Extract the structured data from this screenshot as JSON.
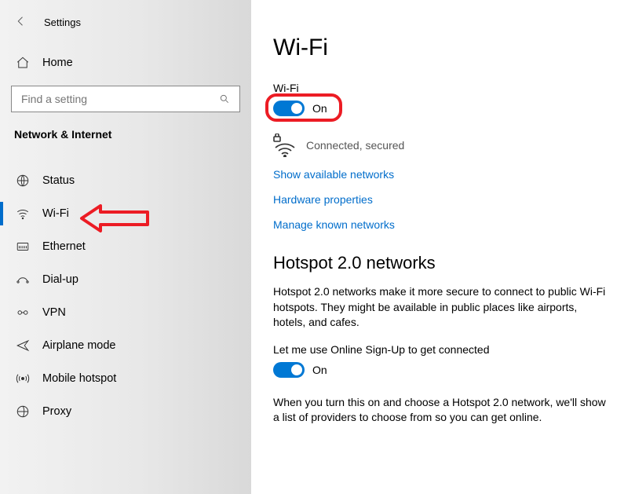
{
  "header": {
    "title": "Settings"
  },
  "sidebar": {
    "home": "Home",
    "searchPlaceholder": "Find a setting",
    "category": "Network & Internet",
    "items": [
      {
        "label": "Status"
      },
      {
        "label": "Wi-Fi"
      },
      {
        "label": "Ethernet"
      },
      {
        "label": "Dial-up"
      },
      {
        "label": "VPN"
      },
      {
        "label": "Airplane mode"
      },
      {
        "label": "Mobile hotspot"
      },
      {
        "label": "Proxy"
      }
    ]
  },
  "main": {
    "title": "Wi-Fi",
    "wifi": {
      "label": "Wi-Fi",
      "toggleState": "On",
      "status": "Connected, secured"
    },
    "links": {
      "available": "Show available networks",
      "hardware": "Hardware properties",
      "manage": "Manage known networks"
    },
    "hotspot": {
      "heading": "Hotspot 2.0 networks",
      "para1": "Hotspot 2.0 networks make it more secure to connect to public Wi-Fi hotspots. They might be available in public places like airports, hotels, and cafes.",
      "optLabel": "Let me use Online Sign-Up to get connected",
      "toggleState": "On",
      "para2": "When you turn this on and choose a Hotspot 2.0 network, we'll show a list of providers to choose from so you can get online."
    }
  }
}
